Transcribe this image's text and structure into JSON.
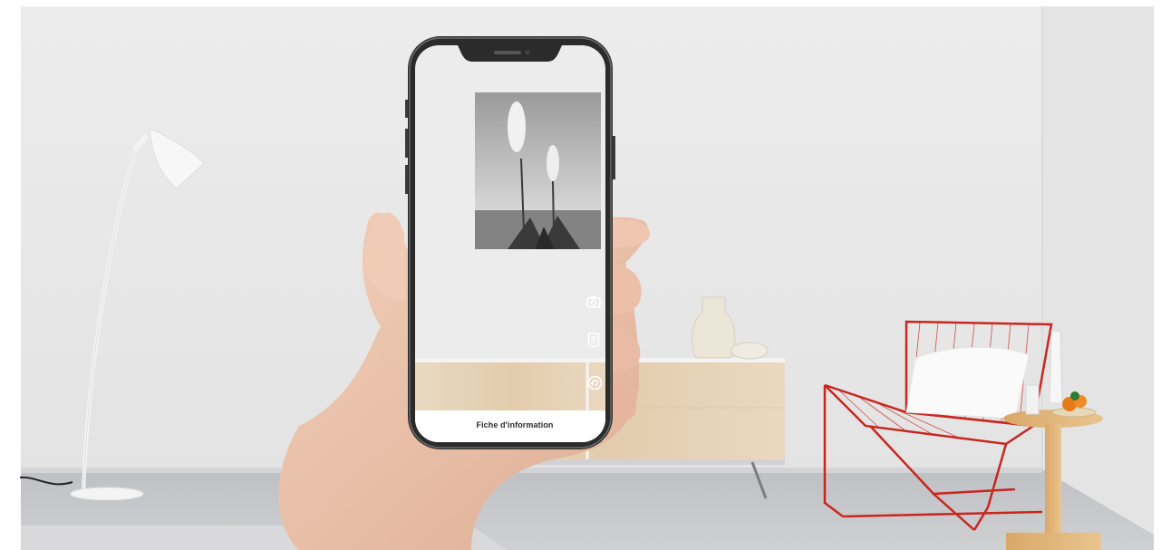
{
  "ar_app": {
    "info_sheet_label": "Fiche d'information",
    "controls": [
      {
        "name": "camera",
        "icon": "camera-icon"
      },
      {
        "name": "details",
        "icon": "document-icon"
      },
      {
        "name": "rotate",
        "icon": "rotate-icon"
      }
    ]
  },
  "scene": {
    "artwork_subject": "yucca-flowers-bw-photo",
    "room": "living-room-with-sideboard-lamp-and-red-wire-chair"
  },
  "colors": {
    "wall": "#e9e9e9",
    "floor": "#c9c9cb",
    "phone_frame": "#2b2b2b",
    "chair_red": "#c8261f",
    "wood": "#e6d3b8"
  }
}
